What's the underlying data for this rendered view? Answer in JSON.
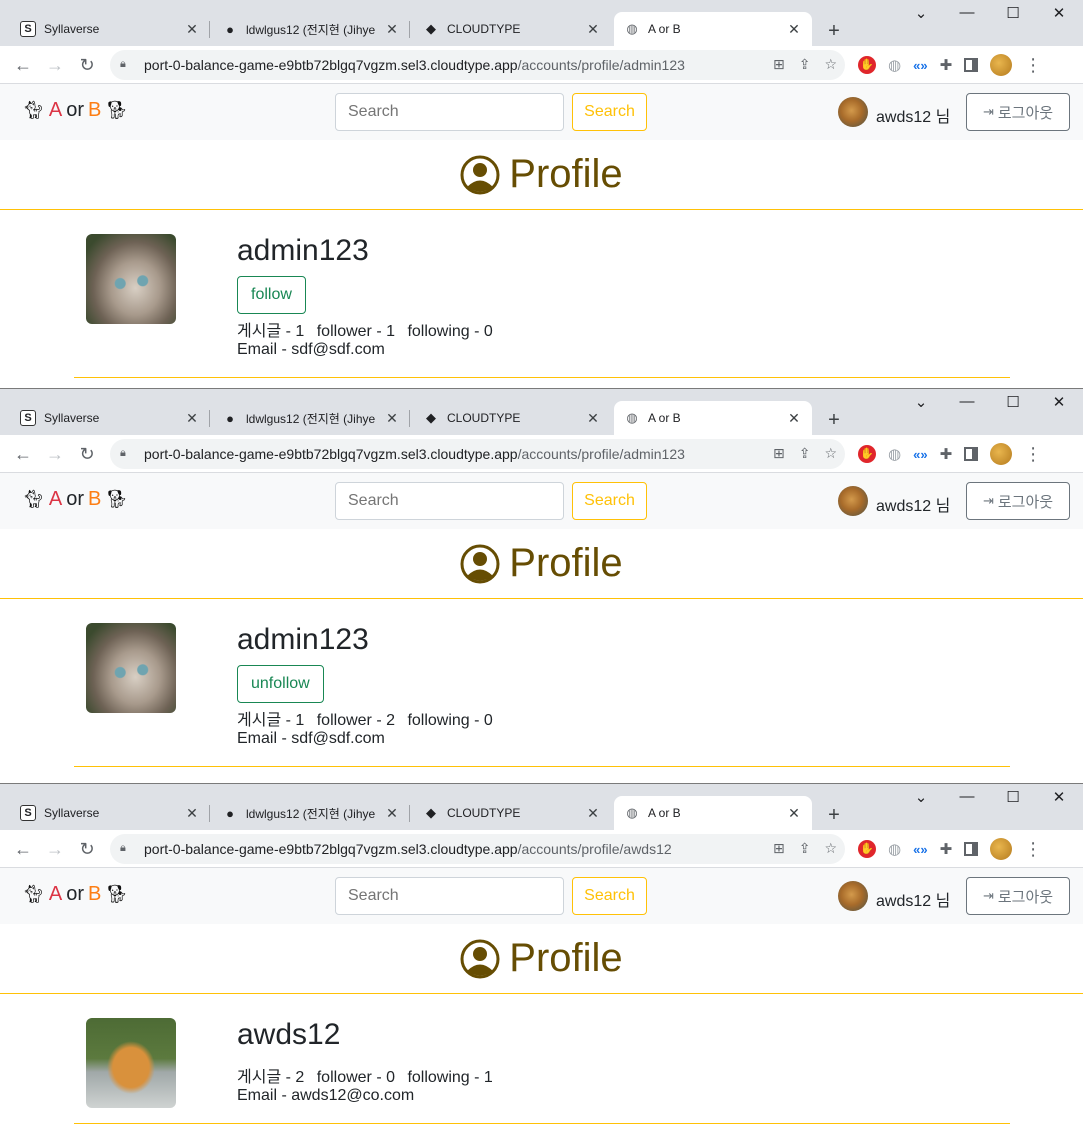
{
  "browser": {
    "tabs": [
      {
        "title": "Syllaverse",
        "favicon": "S"
      },
      {
        "title": "ldwlgus12 (전지현 (Jihye",
        "favicon": "github-icon"
      },
      {
        "title": "CLOUDTYPE",
        "favicon": "cloudtype-icon"
      },
      {
        "title": "A or B",
        "favicon": "globe-icon"
      }
    ],
    "active_tab_index": 3
  },
  "site": {
    "brand": {
      "a": "A",
      "or": "or",
      "b": "B"
    },
    "search_placeholder": "Search",
    "search_button": "Search",
    "username": "awds12 님",
    "logout": "로그아웃"
  },
  "heading": "Profile",
  "panels": [
    {
      "url_host": "port-0-balance-game-e9btb72blgq7vgzm.sel3.cloudtype.app",
      "url_path": "/accounts/profile/admin123",
      "profile": {
        "name": "admin123",
        "follow_label": "follow",
        "posts": "게시글 - 1",
        "followers": "follower - 1",
        "following": "following - 0",
        "email": "Email - sdf@sdf.com"
      }
    },
    {
      "url_host": "port-0-balance-game-e9btb72blgq7vgzm.sel3.cloudtype.app",
      "url_path": "/accounts/profile/admin123",
      "profile": {
        "name": "admin123",
        "follow_label": "unfollow",
        "posts": "게시글 - 1",
        "followers": "follower - 2",
        "following": "following - 0",
        "email": "Email - sdf@sdf.com"
      }
    },
    {
      "url_host": "port-0-balance-game-e9btb72blgq7vgzm.sel3.cloudtype.app",
      "url_path": "/accounts/profile/awds12",
      "profile": {
        "name": "awds12",
        "follow_label": "",
        "posts": "게시글 - 2",
        "followers": "follower - 0",
        "following": "following - 1",
        "email": "Email - awds12@co.com"
      }
    }
  ],
  "colors": {
    "brand_a": "#dc3545",
    "brand_b": "#fd7e14",
    "accent_warning": "#ffc107",
    "follow_green": "#198754",
    "heading": "#664d03"
  }
}
